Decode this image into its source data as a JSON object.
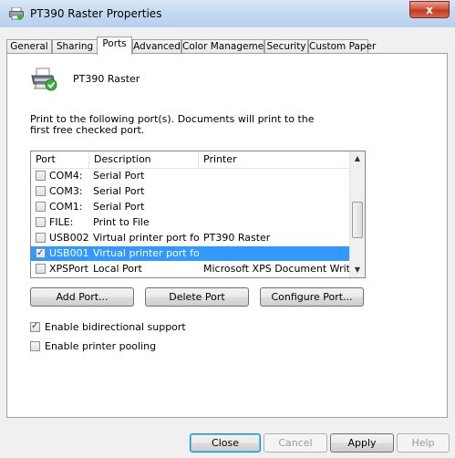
{
  "window": {
    "title": "PT390 Raster Properties",
    "close_label": "x"
  },
  "tabs": [
    {
      "label": "General",
      "active": false
    },
    {
      "label": "Sharing",
      "active": false
    },
    {
      "label": "Ports",
      "active": true
    },
    {
      "label": "Advanced",
      "active": false
    },
    {
      "label": "Color Management",
      "active": false
    },
    {
      "label": "Security",
      "active": false
    },
    {
      "label": "Custom Paper",
      "active": false
    }
  ],
  "printer": {
    "name": "PT390 Raster",
    "icon": "printer-check-icon"
  },
  "description": "Print to the following port(s). Documents will print to the first free checked port.",
  "port_list": {
    "headers": [
      "Port",
      "Description",
      "Printer"
    ],
    "rows": [
      {
        "checked": false,
        "port": "COM4:",
        "description": "Serial Port",
        "printer": "",
        "selected": false
      },
      {
        "checked": false,
        "port": "COM3:",
        "description": "Serial Port",
        "printer": "",
        "selected": false
      },
      {
        "checked": false,
        "port": "COM1:",
        "description": "Serial Port",
        "printer": "",
        "selected": false
      },
      {
        "checked": false,
        "port": "FILE:",
        "description": "Print to File",
        "printer": "",
        "selected": false
      },
      {
        "checked": false,
        "port": "USB002",
        "description": "Virtual printer port for...",
        "printer": "PT390 Raster",
        "selected": false
      },
      {
        "checked": true,
        "port": "USB001",
        "description": "Virtual printer port for...",
        "printer": "",
        "selected": true
      },
      {
        "checked": false,
        "port": "XPSPort:",
        "description": "Local Port",
        "printer": "Microsoft XPS Document Writer",
        "selected": false
      }
    ]
  },
  "port_buttons": {
    "add": "Add Port...",
    "delete": "Delete Port",
    "configure": "Configure Port..."
  },
  "options": {
    "bidirectional": {
      "label": "Enable bidirectional support",
      "checked": true
    },
    "pooling": {
      "label": "Enable printer pooling",
      "checked": false
    }
  },
  "dialog_buttons": {
    "close": "Close",
    "cancel": "Cancel",
    "apply": "Apply",
    "help": "Help"
  },
  "colors": {
    "selection": "#3399ff",
    "titlebar": "#c5daf1",
    "close": "#c03b22"
  }
}
